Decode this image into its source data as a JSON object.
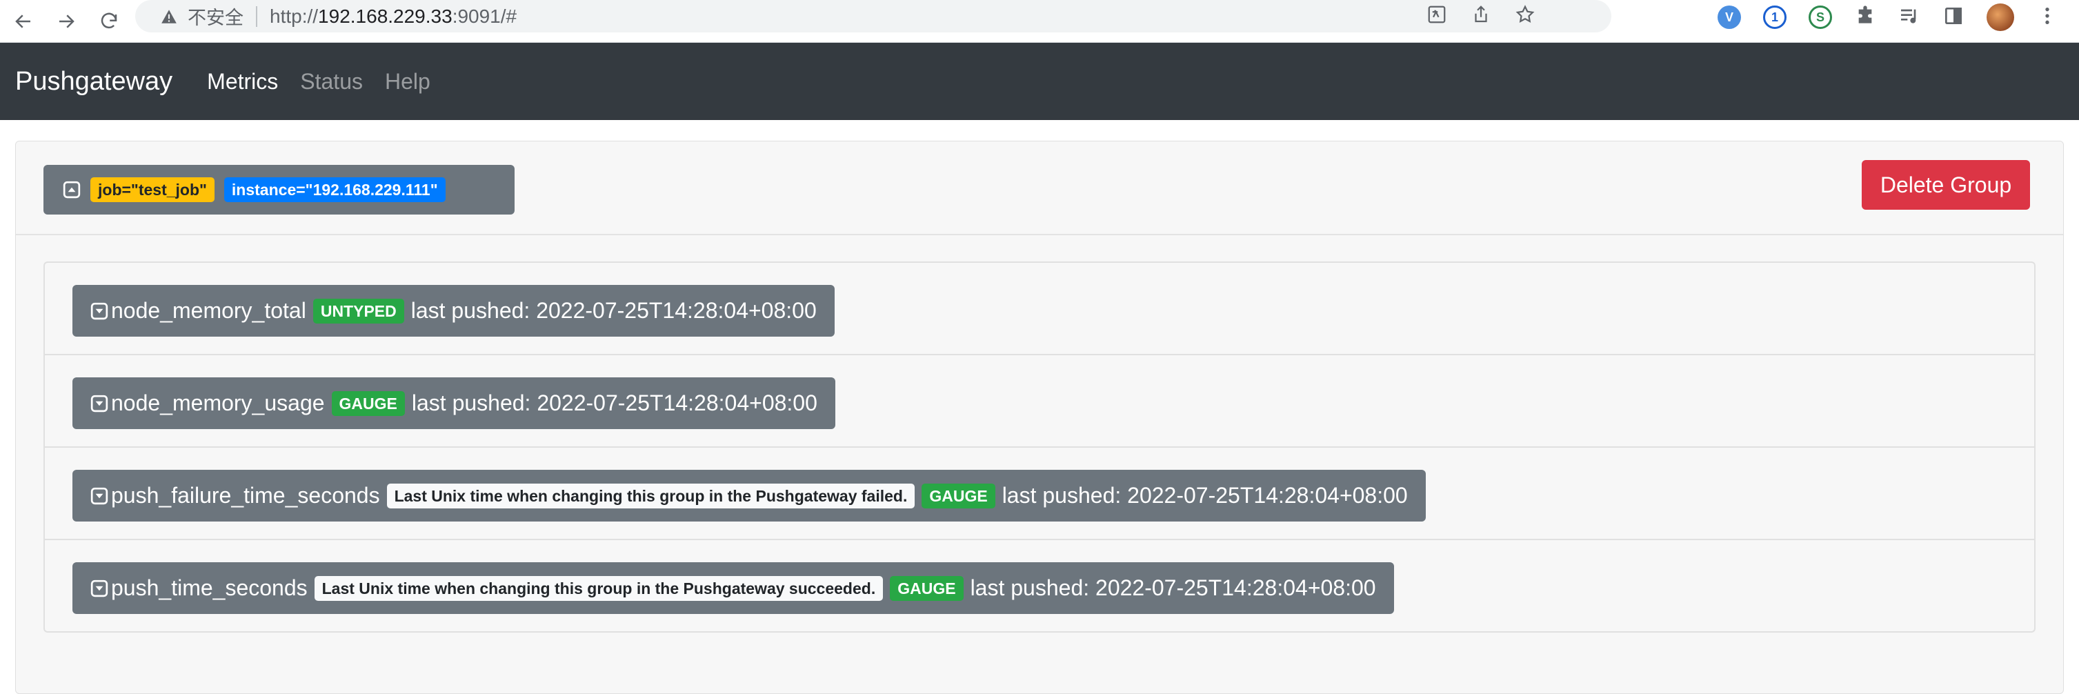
{
  "browser": {
    "security_label": "不安全",
    "url_scheme": "http://",
    "url_host": "192.168.229.33",
    "url_rest": ":9091/#",
    "extension_labels": [
      "V",
      "1",
      "S"
    ]
  },
  "navbar": {
    "brand": "Pushgateway",
    "links": [
      "Metrics",
      "Status",
      "Help"
    ],
    "active": "Metrics"
  },
  "group": {
    "labels": [
      {
        "text": "job=\"test_job\"",
        "color": "#ffc107"
      },
      {
        "text": "instance=\"192.168.229.111\"",
        "color": "#007bff"
      }
    ],
    "delete_label": "Delete Group"
  },
  "metrics": [
    {
      "name": "node_memory_total",
      "help": "",
      "type": "UNTYPED",
      "last_pushed": "last pushed: 2022-07-25T14:28:04+08:00"
    },
    {
      "name": "node_memory_usage",
      "help": "",
      "type": "GAUGE",
      "last_pushed": "last pushed: 2022-07-25T14:28:04+08:00"
    },
    {
      "name": "push_failure_time_seconds",
      "help": "Last Unix time when changing this group in the Pushgateway failed.",
      "type": "GAUGE",
      "last_pushed": "last pushed: 2022-07-25T14:28:04+08:00"
    },
    {
      "name": "push_time_seconds",
      "help": "Last Unix time when changing this group in the Pushgateway succeeded.",
      "type": "GAUGE",
      "last_pushed": "last pushed: 2022-07-25T14:28:04+08:00"
    }
  ]
}
